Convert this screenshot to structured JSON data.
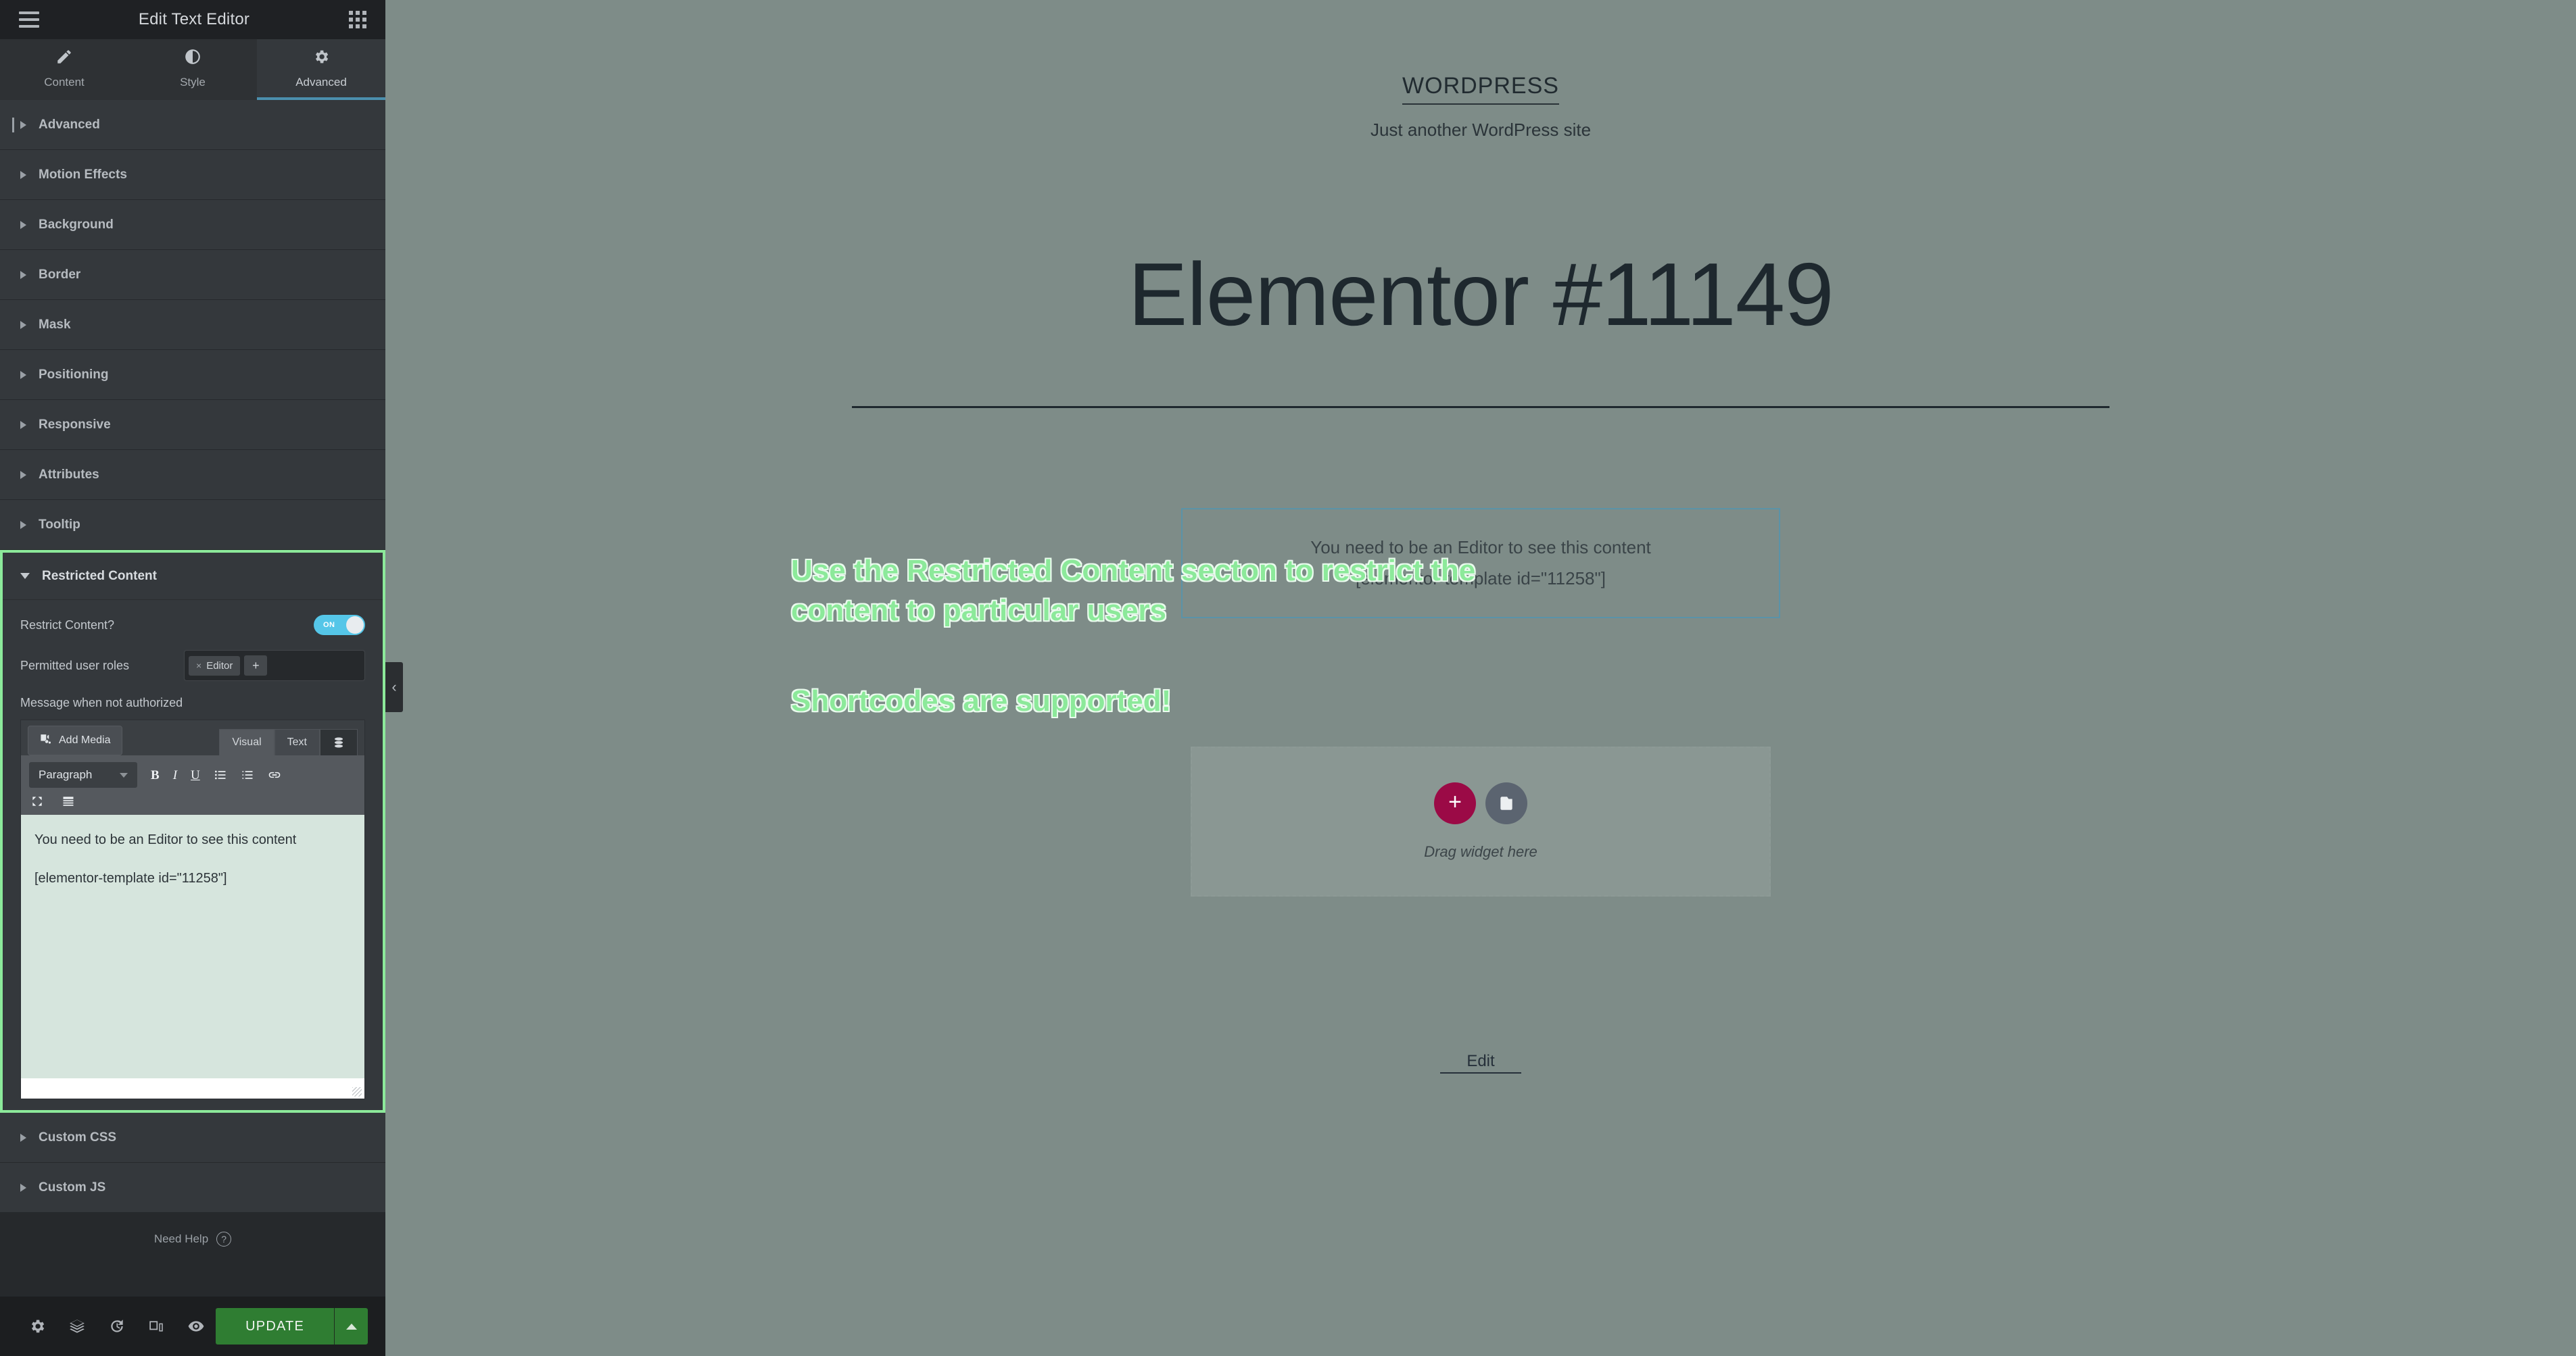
{
  "panel": {
    "title": "Edit Text Editor",
    "menu_icon": "hamburger-menu-icon",
    "apps_icon": "grid-apps-icon",
    "tabs": [
      {
        "label": "Content",
        "icon": "pencil-icon",
        "active": false
      },
      {
        "label": "Style",
        "icon": "contrast-icon",
        "active": false
      },
      {
        "label": "Advanced",
        "icon": "gear-icon",
        "active": true
      }
    ],
    "sections_above": [
      {
        "label": "Advanced"
      },
      {
        "label": "Motion Effects"
      },
      {
        "label": "Background"
      },
      {
        "label": "Border"
      },
      {
        "label": "Mask"
      },
      {
        "label": "Positioning"
      },
      {
        "label": "Responsive"
      },
      {
        "label": "Attributes"
      },
      {
        "label": "Tooltip"
      }
    ],
    "sections_below": [
      {
        "label": "Custom CSS"
      },
      {
        "label": "Custom JS"
      }
    ],
    "restricted_content": {
      "section_title": "Restricted Content",
      "restrict_label": "Restrict Content?",
      "restrict_toggle_state": "ON",
      "roles_label": "Permitted user roles",
      "roles": [
        "Editor"
      ],
      "role_remove_symbol": "×",
      "role_add_symbol": "+",
      "message_label": "Message when not authorized",
      "add_media_label": "Add Media",
      "editor_tabs": [
        "Visual",
        "Text"
      ],
      "format_select": "Paragraph",
      "toolbar_buttons": [
        "B",
        "I",
        "U"
      ],
      "editor_paragraphs": [
        "You need to be an Editor to see this content",
        "[elementor-template id=\"11258\"]"
      ],
      "highlight_color": "#8ce99a",
      "toggle_color": "#55c6e8",
      "editor_bg_color": "#d6e5dd"
    },
    "need_help": "Need Help",
    "footer": {
      "icons": [
        "settings-gear-icon",
        "navigator-layers-icon",
        "history-icon",
        "responsive-mode-icon",
        "preview-eye-icon"
      ],
      "update_label": "UPDATE",
      "update_color": "#2f7d32"
    },
    "collapse_handle_symbol": "‹"
  },
  "canvas": {
    "background_color": "#7e8c88",
    "site_title": "WORDPRESS",
    "site_tagline": "Just another WordPress site",
    "page_title": "Elementor #11149",
    "restricted_preview": [
      "You need to be an Editor to see this content",
      "[elementor-template id=\"11258\"]"
    ],
    "dropzone": {
      "add_symbol": "+",
      "folder_icon": "template-folder-icon",
      "label": "Drag widget here"
    },
    "edit_link": "Edit",
    "annotations": [
      "Use the Restricted Content secton to restrict the content to particular users",
      "Shortcodes are supported!"
    ],
    "annotation_color": "#8ce99a"
  }
}
